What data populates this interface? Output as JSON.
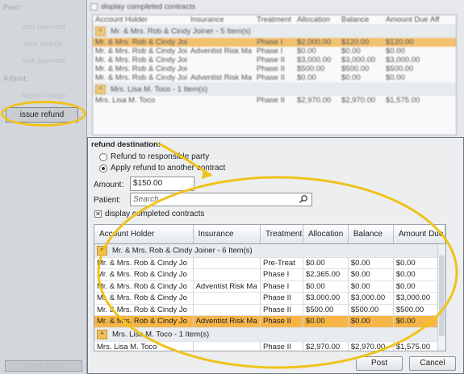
{
  "sidebar": {
    "post_heading": "Post:",
    "post_items": [
      "post payment",
      "post charge",
      "bulk payment"
    ],
    "adjust_heading": "Adjust:",
    "adjust_items": [
      "adjust charge"
    ],
    "issue_refund_label": "issue refund",
    "change_patient_label": "Change Patient"
  },
  "top_panel": {
    "show_completed_label": "display completed contracts",
    "columns": [
      "Account Holder",
      "Insurance",
      "Treatment",
      "Allocation",
      "Balance",
      "Amount Due",
      "Aff"
    ],
    "groups": [
      {
        "title": "Mr. & Mrs. Rob & Cindy Joiner - 5 Item(s)",
        "rows": [
          [
            "Mr. & Mrs. Rob & Cindy Joi",
            "",
            "Phase I",
            "$2,000.00",
            "$120.00",
            "$120.00",
            ""
          ],
          [
            "Mr. & Mrs. Rob & Cindy Joi",
            "Adventist Risk Ma",
            "Phase I",
            "$0.00",
            "$0.00",
            "$0.00",
            ""
          ],
          [
            "Mr. & Mrs. Rob & Cindy Joi",
            "",
            "Phase II",
            "$3,000.00",
            "$3,000.00",
            "$3,000.00",
            ""
          ],
          [
            "Mr. & Mrs. Rob & Cindy Joi",
            "",
            "Phase II",
            "$500.00",
            "$500.00",
            "$500.00",
            ""
          ],
          [
            "Mr. & Mrs. Rob & Cindy Joi",
            "Adventist Risk Ma",
            "Phase II",
            "$0.00",
            "$0.00",
            "$0.00",
            ""
          ]
        ]
      },
      {
        "title": "Mrs. Lisa M. Toco - 1 Item(s)",
        "rows": [
          [
            "Mrs. Lisa M. Toco",
            "",
            "Phase II",
            "$2,970.00",
            "$2,970.00",
            "$1,575.00",
            ""
          ]
        ]
      }
    ]
  },
  "dialog": {
    "title": "refund destination:",
    "radio_responsible": "Refund to responsible party",
    "radio_other_contract": "Apply refund to another contract",
    "amount_label": "Amount:",
    "amount_value": "$150.00",
    "patient_label": "Patient:",
    "patient_placeholder": "Search",
    "show_completed_label": "display completed contracts",
    "columns": [
      "Account Holder",
      "Insurance",
      "Treatment",
      "Allocation",
      "Balance",
      "Amount Due"
    ],
    "groups": [
      {
        "title": "Mr. & Mrs. Rob & Cindy Joiner - 6 Item(s)",
        "rows": [
          [
            "Mr. & Mrs. Rob & Cindy Jo",
            "",
            "Pre-Treat",
            "$0.00",
            "$0.00",
            "$0.00"
          ],
          [
            "Mr. & Mrs. Rob & Cindy Jo",
            "",
            "Phase I",
            "$2,365.00",
            "$0.00",
            "$0.00"
          ],
          [
            "Mr. & Mrs. Rob & Cindy Jo",
            "Adventist Risk Ma",
            "Phase I",
            "$0.00",
            "$0.00",
            "$0.00"
          ],
          [
            "Mr. & Mrs. Rob & Cindy Jo",
            "",
            "Phase II",
            "$3,000.00",
            "$3,000.00",
            "$3,000.00"
          ],
          [
            "Mr. & Mrs. Rob & Cindy Jo",
            "",
            "Phase II",
            "$500.00",
            "$500.00",
            "$500.00"
          ],
          [
            "Mr. & Mrs. Rob & Cindy Jo",
            "Adventist Risk Ma",
            "Phase II",
            "$0.00",
            "$0.00",
            "$0.00"
          ]
        ]
      },
      {
        "title": "Mrs. Lisa M. Toco - 1 Item(s)",
        "rows": [
          [
            "Mrs. Lisa M. Toco",
            "",
            "Phase II",
            "$2,970.00",
            "$2,970.00",
            "$1,575.00"
          ]
        ]
      }
    ],
    "post_label": "Post",
    "cancel_label": "Cancel"
  },
  "colors": {
    "highlight": "#f7b548",
    "callout": "#f0c21a"
  },
  "icons": {
    "search": "magnifier-icon",
    "group_toggle": "caret-up-icon"
  }
}
